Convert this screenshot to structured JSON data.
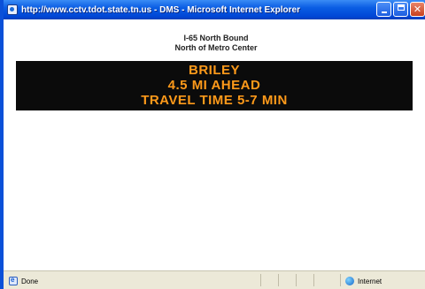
{
  "window": {
    "title": "http://www.cctv.tdot.state.tn.us - DMS - Microsoft Internet Explorer"
  },
  "page": {
    "route_line1": "I-65 North Bound",
    "route_line2": "North of Metro Center",
    "sign": {
      "line1": "BRILEY",
      "line2": "4.5 MI AHEAD",
      "line3": "TRAVEL TIME 5-7 MIN",
      "text_color": "#ff9a1a",
      "background_color": "#0b0b0b"
    }
  },
  "statusbar": {
    "status_text": "Done",
    "zone_text": "Internet"
  },
  "colors": {
    "titlebar": "#0a5de3",
    "frame": "#0a50d8",
    "statusbar_bg": "#ece9d8"
  }
}
